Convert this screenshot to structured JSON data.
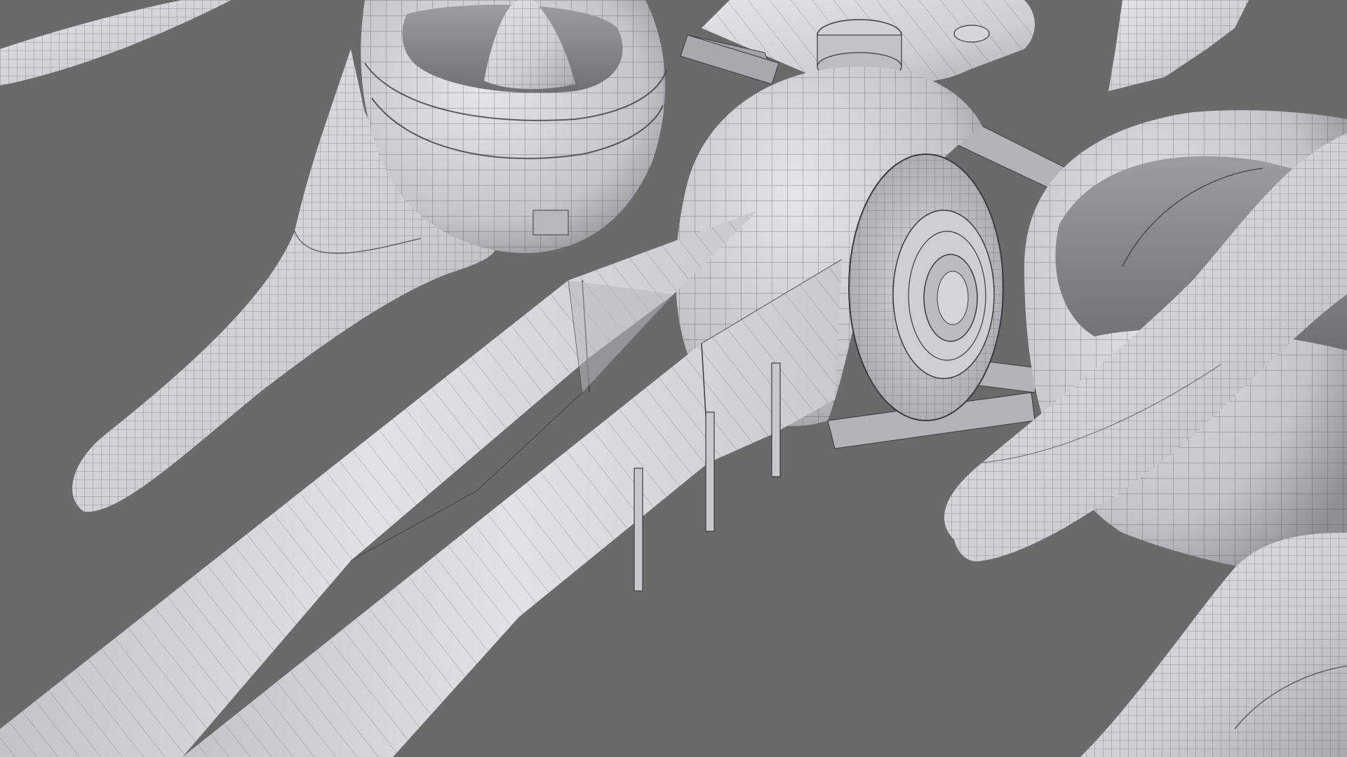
{
  "scene": {
    "background_color": "#6a6a6a",
    "surface_color": "#d6d6d9",
    "surface_shadow_color": "#8e8e93",
    "wire_color": "#3b3b40",
    "parts": [
      "upper-left-tail-fin",
      "left-swept-wing",
      "left-rotor-pod",
      "top-mount-bracket",
      "central-sphere-hull",
      "hub-disc",
      "left-fuselage-boom",
      "right-fuselage-boom",
      "boom-vertical-fins",
      "strut-rods",
      "right-rotor-pod",
      "right-swept-wing",
      "lower-right-wing"
    ]
  }
}
